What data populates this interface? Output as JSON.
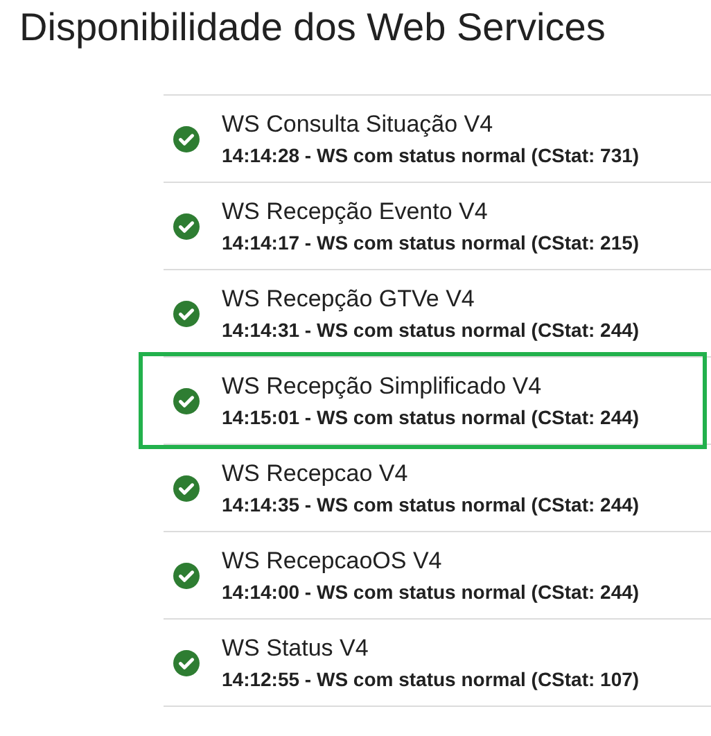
{
  "title": "Disponibilidade dos Web Services",
  "services": [
    {
      "name": "WS Consulta Situação V4",
      "status": "14:14:28 - WS com status normal (CStat: 731)",
      "selected": false
    },
    {
      "name": "WS Recepção Evento V4",
      "status": "14:14:17 - WS com status normal (CStat: 215)",
      "selected": false
    },
    {
      "name": "WS Recepção GTVe V4",
      "status": "14:14:31 - WS com status normal (CStat: 244)",
      "selected": false
    },
    {
      "name": "WS Recepção Simplificado V4",
      "status": "14:15:01 - WS com status normal (CStat: 244)",
      "selected": true
    },
    {
      "name": "WS Recepcao V4",
      "status": "14:14:35 - WS com status normal (CStat: 244)",
      "selected": false
    },
    {
      "name": "WS RecepcaoOS V4",
      "status": "14:14:00 - WS com status normal (CStat: 244)",
      "selected": false
    },
    {
      "name": "WS Status V4",
      "status": "14:12:55 - WS com status normal (CStat: 107)",
      "selected": false
    }
  ]
}
